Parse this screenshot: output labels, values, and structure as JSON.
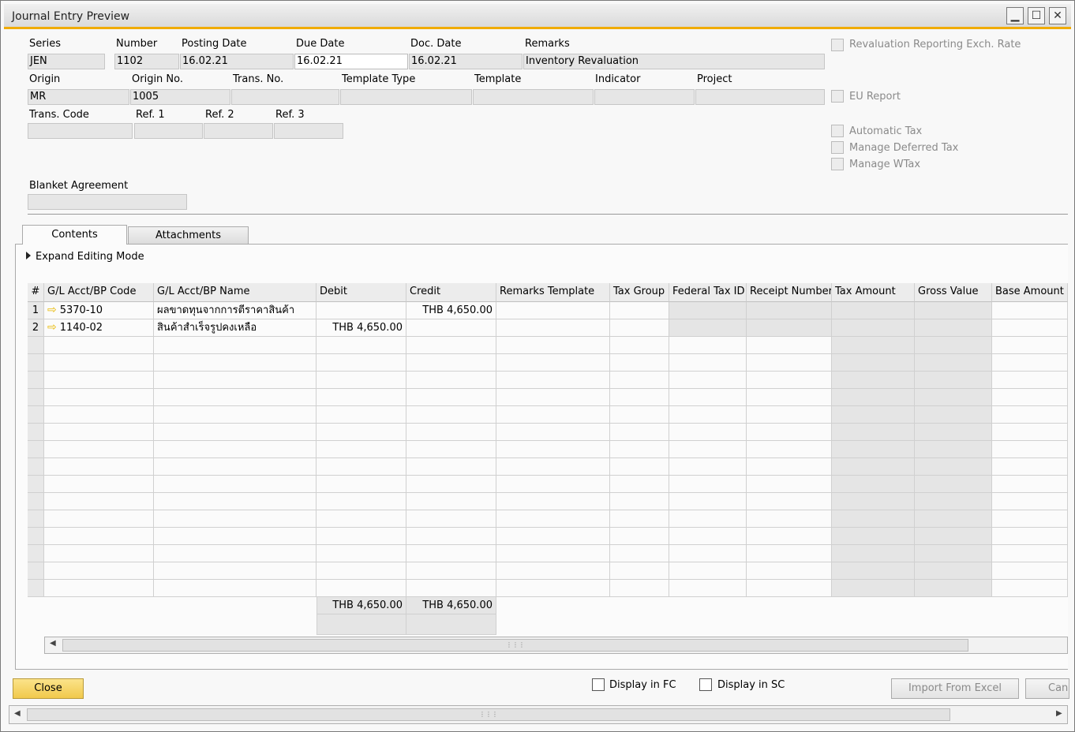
{
  "window": {
    "title": "Journal Entry Preview"
  },
  "header": {
    "series": {
      "label": "Series",
      "value": "JEN"
    },
    "number": {
      "label": "Number",
      "value": "1102"
    },
    "posting_date": {
      "label": "Posting Date",
      "value": "16.02.21"
    },
    "due_date": {
      "label": "Due Date",
      "value": "16.02.21"
    },
    "doc_date": {
      "label": "Doc. Date",
      "value": "16.02.21"
    },
    "remarks": {
      "label": "Remarks",
      "value": "Inventory Revaluation"
    },
    "origin": {
      "label": "Origin",
      "value": "MR"
    },
    "origin_no": {
      "label": "Origin No.",
      "value": "1005"
    },
    "trans_no": {
      "label": "Trans. No.",
      "value": ""
    },
    "template_type": {
      "label": "Template Type",
      "value": ""
    },
    "template": {
      "label": "Template",
      "value": ""
    },
    "indicator": {
      "label": "Indicator",
      "value": ""
    },
    "project": {
      "label": "Project",
      "value": ""
    },
    "trans_code": {
      "label": "Trans. Code",
      "value": ""
    },
    "ref1": {
      "label": "Ref. 1",
      "value": ""
    },
    "ref2": {
      "label": "Ref. 2",
      "value": ""
    },
    "ref3": {
      "label": "Ref. 3",
      "value": ""
    },
    "blanket_agreement": {
      "label": "Blanket Agreement",
      "value": ""
    }
  },
  "options": {
    "revaluation_reporting": "Revaluation Reporting Exch. Rate",
    "eu_report": "EU Report",
    "automatic_tax": "Automatic Tax",
    "manage_deferred_tax": "Manage Deferred Tax",
    "manage_wtax": "Manage WTax"
  },
  "tabs": {
    "contents": "Contents",
    "attachments": "Attachments"
  },
  "expand_label": "Expand Editing Mode",
  "grid": {
    "columns": [
      "#",
      "G/L Acct/BP Code",
      "G/L Acct/BP Name",
      "Debit",
      "Credit",
      "Remarks Template",
      "Tax Group",
      "Federal Tax ID",
      "Receipt Number",
      "Tax Amount",
      "Gross Value",
      "Base Amount"
    ],
    "rows": [
      {
        "num": "1",
        "code": "5370-10",
        "name": "ผลขาดทุนจากการตีราคาสินค้า",
        "debit": "",
        "credit": "THB 4,650.00"
      },
      {
        "num": "2",
        "code": "1140-02",
        "name": "สินค้าสำเร็จรูปคงเหลือ",
        "debit": "THB 4,650.00",
        "credit": ""
      }
    ],
    "totals": {
      "debit": "THB 4,650.00",
      "credit": "THB 4,650.00"
    }
  },
  "footer": {
    "close": "Close",
    "display_fc": "Display in FC",
    "display_sc": "Display in SC",
    "import_excel": "Import From Excel",
    "cancel": "Can"
  },
  "colors": {
    "accent": "#f0ab00",
    "primary_button": "#f1c94c",
    "disabled_field": "#e6e6e6"
  },
  "icons": {
    "row_arrow": "link-arrow-icon",
    "expand": "triangle-right-icon"
  }
}
